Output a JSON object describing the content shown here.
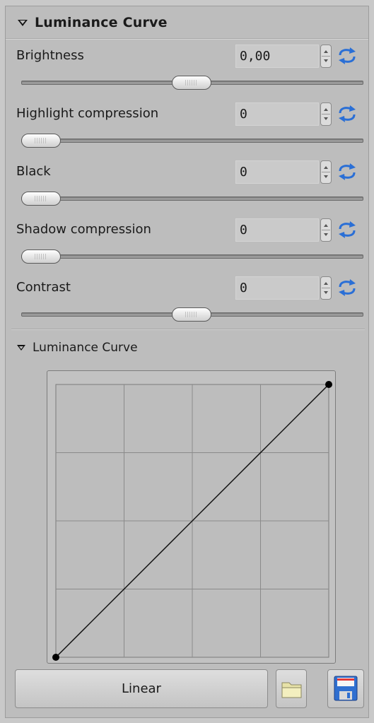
{
  "panel": {
    "title": "Luminance Curve",
    "sliders": [
      {
        "label": "Brightness",
        "value": "0,00",
        "position": 0.5
      },
      {
        "label": "Highlight compression",
        "value": "0",
        "position": 0.0
      },
      {
        "label": "Black",
        "value": "0",
        "position": 0.0
      },
      {
        "label": "Shadow compression",
        "value": "0",
        "position": 0.0
      },
      {
        "label": "Contrast",
        "value": "0",
        "position": 0.5
      }
    ],
    "reset_icon": "reset-icon"
  },
  "curve": {
    "title": "Luminance Curve",
    "points": [
      [
        0,
        0
      ],
      [
        1,
        1
      ]
    ],
    "grid_divisions": 4
  },
  "buttons": {
    "curve_type": "Linear",
    "open_icon": "folder-open-icon",
    "save_icon": "floppy-save-icon"
  },
  "colors": {
    "background": "#bdbdbd",
    "accent_reset": "#2a6fd6"
  }
}
